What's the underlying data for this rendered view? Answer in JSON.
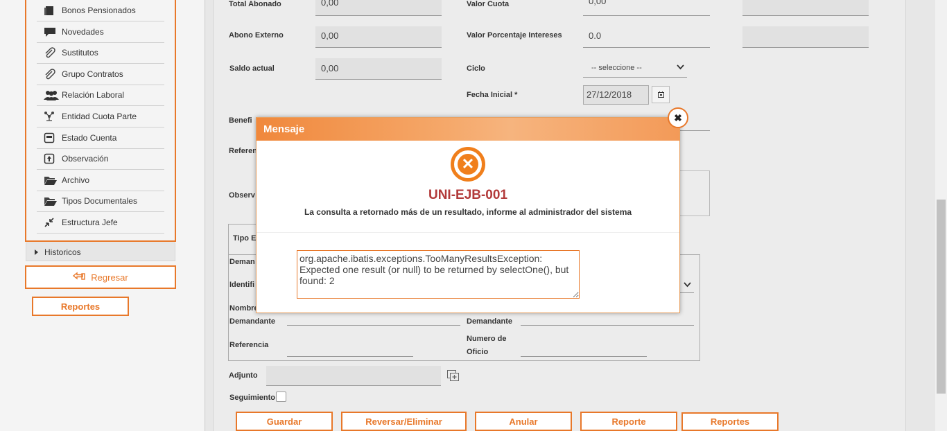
{
  "sidebar": {
    "items": [
      {
        "label": "Bonos Pensionados",
        "icon": "book-icon"
      },
      {
        "label": "Novedades",
        "icon": "chat-icon"
      },
      {
        "label": "Sustitutos",
        "icon": "paperclip-icon"
      },
      {
        "label": "Grupo Contratos",
        "icon": "paperclip-icon"
      },
      {
        "label": "Relación Laboral",
        "icon": "users-icon"
      },
      {
        "label": "Entidad Cuota Parte",
        "icon": "network-icon"
      },
      {
        "label": "Estado Cuenta",
        "icon": "statement-icon"
      },
      {
        "label": "Observación",
        "icon": "upload-box-icon"
      },
      {
        "label": "Archivo",
        "icon": "folder-open-icon"
      },
      {
        "label": "Tipos Documentales",
        "icon": "folder-open-icon"
      },
      {
        "label": "Estructura Jefe",
        "icon": "compress-icon"
      }
    ],
    "historicos": "Historicos",
    "regresar": "Regresar",
    "reportes": "Reportes"
  },
  "form": {
    "total_abonado": {
      "label": "Total Abonado",
      "value": "0,00"
    },
    "valor_cuota": {
      "label": "Valor Cuota",
      "value": "0,00"
    },
    "abono_externo": {
      "label": "Abono Externo",
      "value": "0,00"
    },
    "valor_porcentaje": {
      "label": "Valor Porcentaje Intereses",
      "value": "0.0"
    },
    "saldo_actual": {
      "label": "Saldo actual",
      "value": "0,00"
    },
    "ciclo": {
      "label": "Ciclo",
      "value": "-- seleccione --"
    },
    "fecha_inicial": {
      "label": "Fecha Inicial *",
      "value": "27/12/2018"
    },
    "benef_partial": "Benefi",
    "refer_partial": "Referen",
    "observ_partial": "Observ",
    "tipo_partial": "Tipo E",
    "demand_partial": "Deman",
    "identif_partial": "Identifi",
    "nombre_partial": "Nombre",
    "demandante_left": "Demandante",
    "demandante_right": "Demandante",
    "referencia": "Referencia",
    "numero_oficio_1": "Numero de",
    "numero_oficio_2": "Oficio",
    "adjunto": "Adjunto",
    "seguimiento": "Seguimiento"
  },
  "actions": {
    "guardar": "Guardar",
    "reversar": "Reversar/Eliminar",
    "anular": "Anular",
    "reporte": "Reporte",
    "reportes": "Reportes"
  },
  "dialog": {
    "title": "Mensaje",
    "code": "UNI-EJB-001",
    "message": "La consulta a retornado más de un resultado, informe al administrador del sistema",
    "detail": "org.apache.ibatis.exceptions.TooManyResultsException: Expected one result (or null) to be returned by selectOne(), but found: 2"
  },
  "colors": {
    "accent": "#e8782a",
    "error_code": "#b23a3a"
  }
}
